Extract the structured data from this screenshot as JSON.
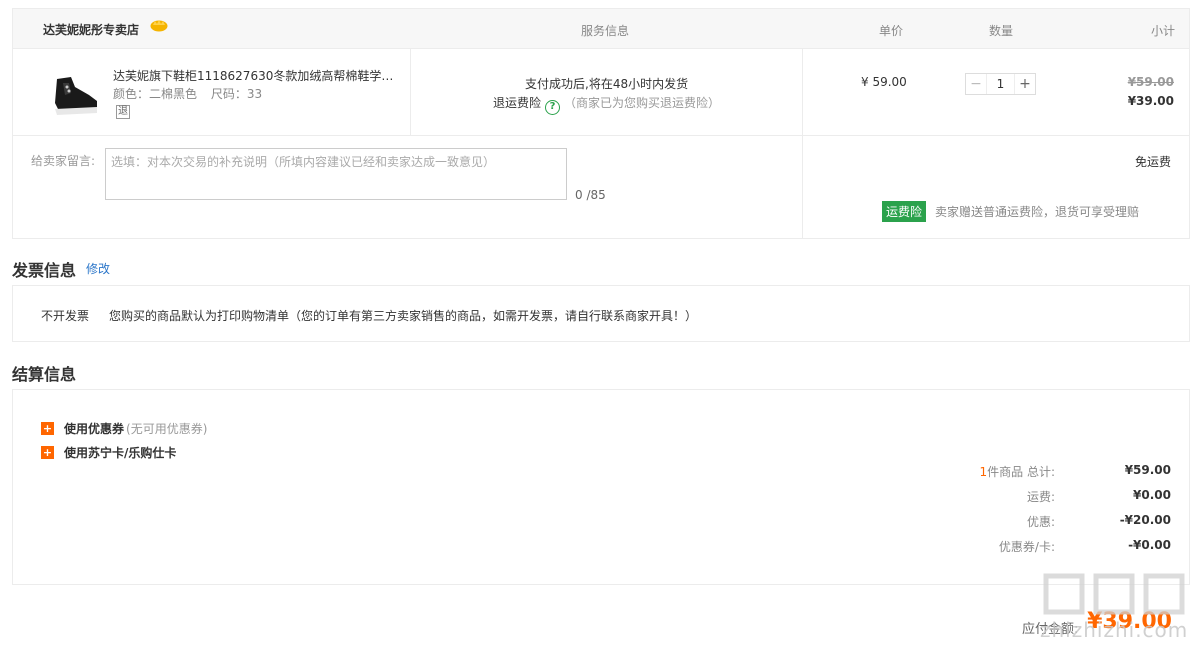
{
  "store": {
    "name": "达芙妮妮彤专卖店",
    "badge_icon": "crown-icon"
  },
  "headers": {
    "service": "服务信息",
    "unit_price": "单价",
    "quantity": "数量",
    "subtotal": "小计"
  },
  "item": {
    "title": "达芙妮旗下鞋柜1118627630冬款加绒高帮棉鞋学生...",
    "color_label": "颜色：二棉黑色",
    "size_label": "尺码：33",
    "return_tag": "退",
    "service_line1": "支付成功后,将在48小时内发货",
    "service_insurance": "退运费险",
    "service_note": "（商家已为您购买退运费险）",
    "unit_price": "¥ 59.00",
    "quantity": "1",
    "qty_minus": "−",
    "qty_plus": "+",
    "old_subtotal": "¥59.00",
    "new_subtotal": "¥39.00"
  },
  "message": {
    "label": "给卖家留言:",
    "placeholder": "选填：对本次交易的补充说明（所填内容建议已经和卖家达成一致意见）",
    "count": "0 /85",
    "free_shipping": "免运费",
    "insurance_tag": "运费险",
    "insurance_text": "卖家赠送普通运费险，退货可享受理赔"
  },
  "invoice": {
    "title": "发票信息",
    "edit_label": "修改",
    "type": "不开发票",
    "desc": "您购买的商品默认为打印购物清单（您的订单有第三方卖家销售的商品，如需开发票，请自行联系商家开具！）"
  },
  "settlement": {
    "title": "结算信息",
    "coupon_label": "使用优惠券",
    "coupon_sub": "(无可用优惠券)",
    "card_label": "使用苏宁卡/乐购仕卡",
    "item_count": "1",
    "total_label": "件商品 总计:",
    "total_value": "¥59.00",
    "shipping_label": "运费:",
    "shipping_value": "¥0.00",
    "discount_label": "优惠:",
    "discount_value": "-¥20.00",
    "voucher_label": "优惠券/卡:",
    "voucher_value": "-¥0.00",
    "payable_label": "应付金额:",
    "payable_value": "¥39.00"
  },
  "watermark": {
    "text": "zhizhizhi.com"
  },
  "colors": {
    "accent_orange": "#ff6600",
    "insurance_green": "#2ba24c",
    "link_blue": "#2b76c9"
  }
}
